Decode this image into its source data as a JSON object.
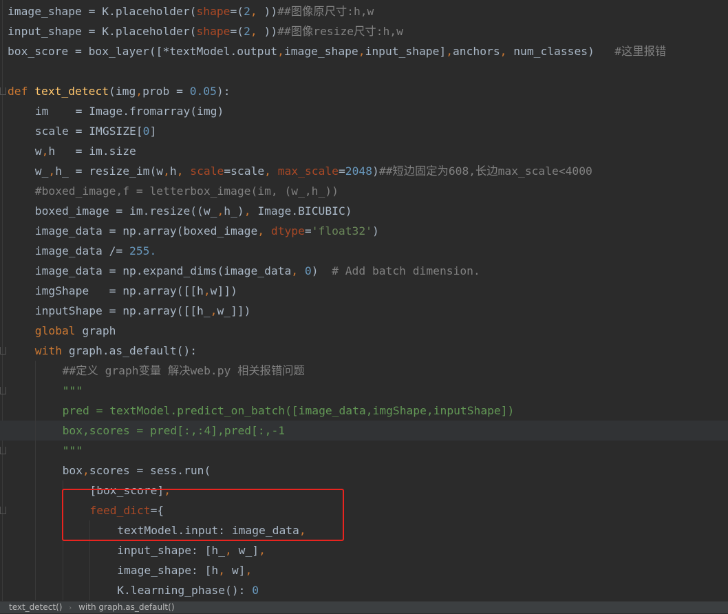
{
  "editor": {
    "lines": [
      {
        "indent": 0,
        "tokens": [
          [
            "plain",
            "image_shape = K.placeholder("
          ],
          [
            "param",
            "shape"
          ],
          [
            "plain",
            "=("
          ],
          [
            "num",
            "2"
          ],
          [
            "punct",
            ", "
          ],
          [
            "plain",
            "))"
          ],
          [
            "cmt",
            "##图像原尺寸:h,w"
          ]
        ]
      },
      {
        "indent": 0,
        "tokens": [
          [
            "plain",
            "input_shape = K.placeholder("
          ],
          [
            "param",
            "shape"
          ],
          [
            "plain",
            "=("
          ],
          [
            "num",
            "2"
          ],
          [
            "punct",
            ", "
          ],
          [
            "plain",
            "))"
          ],
          [
            "cmt",
            "##图像resize尺寸:h,w"
          ]
        ]
      },
      {
        "indent": 0,
        "tokens": [
          [
            "plain",
            "box_score = box_layer([*textModel.output"
          ],
          [
            "punct",
            ","
          ],
          [
            "plain",
            "image_shape"
          ],
          [
            "punct",
            ","
          ],
          [
            "plain",
            "input_shape]"
          ],
          [
            "punct",
            ","
          ],
          [
            "plain",
            "anchors"
          ],
          [
            "punct",
            ", "
          ],
          [
            "plain",
            "num_classes)   "
          ],
          [
            "cmt",
            "#这里报错"
          ]
        ]
      },
      {
        "indent": 0,
        "tokens": []
      },
      {
        "indent": 0,
        "tokens": [
          [
            "kw",
            "def "
          ],
          [
            "fn",
            "text_detect"
          ],
          [
            "plain",
            "(img"
          ],
          [
            "punct",
            ","
          ],
          [
            "plain",
            "prob = "
          ],
          [
            "num",
            "0.05"
          ],
          [
            "plain",
            "):"
          ]
        ]
      },
      {
        "indent": 1,
        "tokens": [
          [
            "plain",
            "im    = Image.fromarray(img)"
          ]
        ]
      },
      {
        "indent": 1,
        "tokens": [
          [
            "plain",
            "scale = IMGSIZE["
          ],
          [
            "num",
            "0"
          ],
          [
            "plain",
            "]"
          ]
        ]
      },
      {
        "indent": 1,
        "tokens": [
          [
            "plain",
            "w"
          ],
          [
            "punct",
            ","
          ],
          [
            "plain",
            "h   = im.size"
          ]
        ]
      },
      {
        "indent": 1,
        "tokens": [
          [
            "plain",
            "w_"
          ],
          [
            "punct",
            ","
          ],
          [
            "plain",
            "h_ = resize_im(w"
          ],
          [
            "punct",
            ","
          ],
          [
            "plain",
            "h"
          ],
          [
            "punct",
            ", "
          ],
          [
            "param",
            "scale"
          ],
          [
            "plain",
            "=scale"
          ],
          [
            "punct",
            ", "
          ],
          [
            "param",
            "max_scale"
          ],
          [
            "plain",
            "="
          ],
          [
            "num",
            "2048"
          ],
          [
            "plain",
            ")"
          ],
          [
            "cmt",
            "##短边固定为608,长边max_scale<4000"
          ]
        ]
      },
      {
        "indent": 1,
        "tokens": [
          [
            "cmt",
            "#boxed_image,f = letterbox_image(im, (w_,h_))"
          ]
        ]
      },
      {
        "indent": 1,
        "tokens": [
          [
            "plain",
            "boxed_image = im.resize((w_"
          ],
          [
            "punct",
            ","
          ],
          [
            "plain",
            "h_)"
          ],
          [
            "punct",
            ", "
          ],
          [
            "plain",
            "Image.BICUBIC)"
          ]
        ]
      },
      {
        "indent": 1,
        "tokens": [
          [
            "plain",
            "image_data = np.array(boxed_image"
          ],
          [
            "punct",
            ", "
          ],
          [
            "param",
            "dtype"
          ],
          [
            "plain",
            "="
          ],
          [
            "str",
            "'float32'"
          ],
          [
            "plain",
            ")"
          ]
        ]
      },
      {
        "indent": 1,
        "tokens": [
          [
            "plain",
            "image_data /= "
          ],
          [
            "num",
            "255."
          ]
        ]
      },
      {
        "indent": 1,
        "tokens": [
          [
            "plain",
            "image_data = np.expand_dims(image_data"
          ],
          [
            "punct",
            ", "
          ],
          [
            "num",
            "0"
          ],
          [
            "plain",
            ")  "
          ],
          [
            "cmt",
            "# Add batch dimension."
          ]
        ]
      },
      {
        "indent": 1,
        "tokens": [
          [
            "plain",
            "imgShape   = np.array([[h"
          ],
          [
            "punct",
            ","
          ],
          [
            "plain",
            "w]])"
          ]
        ]
      },
      {
        "indent": 1,
        "tokens": [
          [
            "plain",
            "inputShape = np.array([[h_"
          ],
          [
            "punct",
            ","
          ],
          [
            "plain",
            "w_]])"
          ]
        ]
      },
      {
        "indent": 1,
        "tokens": [
          [
            "kw",
            "global "
          ],
          [
            "plain",
            "graph"
          ]
        ]
      },
      {
        "indent": 1,
        "tokens": [
          [
            "kw",
            "with "
          ],
          [
            "plain",
            "graph.as_default():"
          ]
        ]
      },
      {
        "indent": 2,
        "tokens": [
          [
            "cmt",
            "##定义 graph变量 解决web.py 相关报错问题"
          ]
        ]
      },
      {
        "indent": 2,
        "tokens": [
          [
            "doc",
            "\"\"\""
          ]
        ]
      },
      {
        "indent": 2,
        "tokens": [
          [
            "doc",
            "pred = textModel.predict_on_batch([image_data,imgShape,inputShape])"
          ]
        ]
      },
      {
        "indent": 2,
        "tokens": [
          [
            "doc",
            "box,scores = pred[:,:4],pred[:,-1"
          ]
        ]
      },
      {
        "indent": 2,
        "tokens": [
          [
            "doc",
            "\"\"\""
          ]
        ]
      },
      {
        "indent": 2,
        "tokens": [
          [
            "plain",
            "box"
          ],
          [
            "punct",
            ","
          ],
          [
            "plain",
            "scores = sess.run("
          ]
        ]
      },
      {
        "indent": 3,
        "tokens": [
          [
            "plain",
            "[box_score]"
          ],
          [
            "punct",
            ","
          ]
        ]
      },
      {
        "indent": 3,
        "tokens": [
          [
            "param",
            "feed_dict"
          ],
          [
            "plain",
            "={"
          ]
        ]
      },
      {
        "indent": 4,
        "tokens": [
          [
            "plain",
            "textModel.input: image_data"
          ],
          [
            "punct",
            ","
          ]
        ]
      },
      {
        "indent": 4,
        "tokens": [
          [
            "plain",
            "input_shape: [h_"
          ],
          [
            "punct",
            ", "
          ],
          [
            "plain",
            "w_]"
          ],
          [
            "punct",
            ","
          ]
        ]
      },
      {
        "indent": 4,
        "tokens": [
          [
            "plain",
            "image_shape: [h"
          ],
          [
            "punct",
            ", "
          ],
          [
            "plain",
            "w]"
          ],
          [
            "punct",
            ","
          ]
        ]
      },
      {
        "indent": 4,
        "tokens": [
          [
            "plain",
            "K.learning_phase(): "
          ],
          [
            "num",
            "0"
          ]
        ]
      }
    ],
    "highlighted_lines": [
      21
    ]
  },
  "breadcrumb": {
    "items": [
      "text_detect()",
      "with graph.as_default()"
    ],
    "separator": "›"
  },
  "colors": {
    "background": "#2b2b2b",
    "keyword": "#cc7832",
    "function": "#ffc66d",
    "number": "#6897bb",
    "string": "#6a8759",
    "comment": "#808080",
    "docstring": "#629755",
    "parameter": "#aa4926",
    "identifier": "#a9b7c6",
    "highlight_box": "#e8241f"
  }
}
